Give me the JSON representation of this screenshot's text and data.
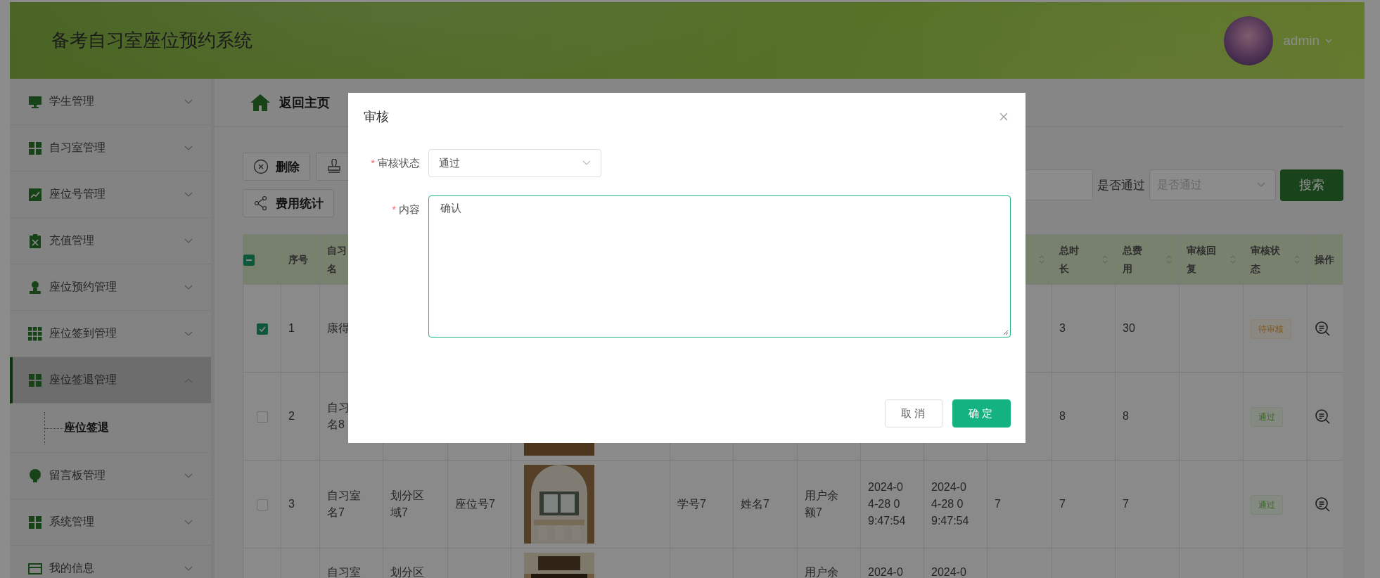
{
  "header": {
    "title": "备考自习室座位预约系统",
    "user": "admin"
  },
  "sidebar": {
    "items": [
      {
        "label": "学生管理",
        "expanded": false,
        "selected": false
      },
      {
        "label": "自习室管理",
        "expanded": false,
        "selected": false
      },
      {
        "label": "座位号管理",
        "expanded": false,
        "selected": false
      },
      {
        "label": "充值管理",
        "expanded": false,
        "selected": false
      },
      {
        "label": "座位预约管理",
        "expanded": false,
        "selected": false
      },
      {
        "label": "座位签到管理",
        "expanded": false,
        "selected": false
      },
      {
        "label": "座位签退管理",
        "expanded": true,
        "selected": true,
        "children": [
          {
            "label": "座位签退"
          }
        ]
      },
      {
        "label": "留言板管理",
        "expanded": false,
        "selected": false
      },
      {
        "label": "系统管理",
        "expanded": false,
        "selected": false
      },
      {
        "label": "我的信息",
        "expanded": false,
        "selected": false
      }
    ]
  },
  "breadcrumb": {
    "label": "返回主页"
  },
  "toolbar": {
    "buttons": [
      {
        "label": "删除",
        "kind": "delete"
      },
      {
        "kind": "stamp"
      },
      {
        "label": "费用统计",
        "kind": "stats"
      }
    ]
  },
  "search": {
    "label": "是否通过",
    "select_placeholder": "是否通过",
    "button": "搜索"
  },
  "table": {
    "header_checkbox": {
      "indeterminate": true
    },
    "columns": [
      {
        "label": "序号"
      },
      {
        "label": [
          "自习",
          "名"
        ]
      },
      {},
      {},
      {},
      {},
      {},
      {},
      {},
      {},
      {
        "sortable": true
      },
      {
        "label": "总时长",
        "sortable": true
      },
      {
        "label": "总费用",
        "sortable": true
      },
      {
        "label": "审核回复",
        "sortable": true
      },
      {
        "label": "审核状态",
        "sortable": true
      },
      {
        "label": "操作"
      }
    ],
    "rows": [
      {
        "selected": true,
        "cells": [
          "1",
          "康得",
          null,
          null,
          null,
          null,
          null,
          null,
          null,
          null,
          null,
          "3",
          "30",
          null,
          {
            "kind": "pending",
            "text": "待审核"
          },
          {
            "kind": "detail"
          }
        ]
      },
      {
        "selected": false,
        "cells": [
          "2",
          [
            "自习",
            "名8"
          ],
          null,
          null,
          {
            "kind": "picture"
          },
          null,
          null,
          null,
          null,
          null,
          null,
          "8",
          "8",
          null,
          {
            "kind": "approved",
            "text": "通过"
          },
          {
            "kind": "detail"
          }
        ]
      },
      {
        "selected": false,
        "cells": [
          "3",
          "自习室名7",
          "划分区域7",
          "座位号7",
          {
            "kind": "picture"
          },
          "学号7",
          "姓名7",
          "用户余额7",
          "2024-0\n4-28 0\n9:47:54",
          "2024-0\n4-28 0\n9:47:54",
          "7",
          "7",
          "7",
          null,
          {
            "kind": "approved",
            "text": "通过"
          },
          {
            "kind": "detail"
          }
        ]
      },
      {
        "cells": [
          null,
          "自习室",
          "划分区",
          null,
          {
            "kind": "picture"
          },
          null,
          null,
          "用户余",
          "2024-0",
          "2024-0",
          null,
          null,
          null,
          null,
          null,
          null
        ]
      }
    ]
  },
  "dialog": {
    "title": "审核",
    "fields": [
      {
        "label": "审核状态",
        "required_mark": "*",
        "kind": "select",
        "value": "通过"
      },
      {
        "label": "内容",
        "required_mark": "*",
        "kind": "textarea",
        "value": "确认"
      }
    ],
    "buttons": [
      {
        "label": "取消",
        "kind": "secondary"
      },
      {
        "label": "确定",
        "kind": "primary"
      }
    ]
  }
}
